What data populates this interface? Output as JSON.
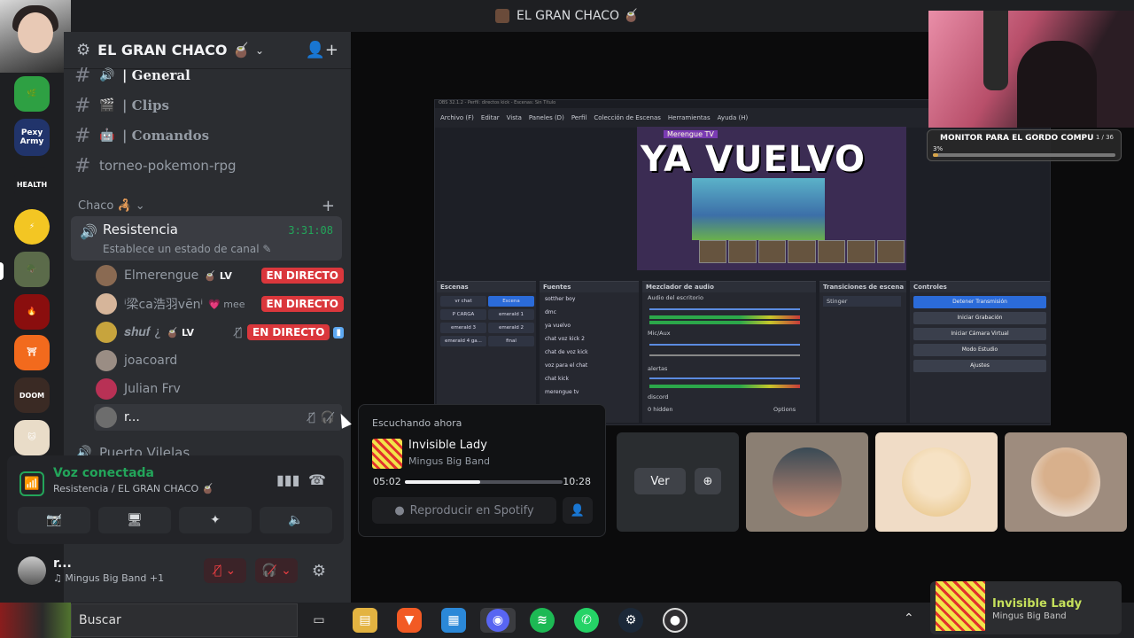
{
  "window": {
    "title": "EL GRAN CHACO 🧉"
  },
  "rail": {
    "servers": [
      {
        "name": "green-leaf-server",
        "text": ""
      },
      {
        "name": "pexy-army-server",
        "text": "Pexy Army"
      },
      {
        "name": "health-server",
        "text": "HEALTH"
      },
      {
        "name": "pikachu-server",
        "text": ""
      },
      {
        "name": "camo-server",
        "text": ""
      },
      {
        "name": "red-logo-server",
        "text": ""
      },
      {
        "name": "orange-server",
        "text": ""
      },
      {
        "name": "doom-server",
        "text": ""
      },
      {
        "name": "cat-server",
        "text": ""
      }
    ]
  },
  "guild": {
    "name": "EL GRAN CHACO 🧉"
  },
  "channels": [
    {
      "label": "| General",
      "emoji": "🔊"
    },
    {
      "label": "| Clips",
      "emoji": "🎬"
    },
    {
      "label": "| Comandos",
      "emoji": "🤖"
    },
    {
      "label": "torneo-pokemon-rpg",
      "emoji": ""
    }
  ],
  "category": {
    "label": "Chaco 🦂"
  },
  "voice_channel": {
    "name": "Resistencia",
    "timer": "3:31:08",
    "status_placeholder": "Establece un estado de canal"
  },
  "members": [
    {
      "name": "Elmerengue",
      "tag": "LV",
      "live": "EN DIRECTO",
      "color": "#8a6a52"
    },
    {
      "name": "ⁱ梁ca浩羽vēnⁱ",
      "tag": "mee",
      "live": "EN DIRECTO",
      "color": "#d6b59a"
    },
    {
      "name": "𝒔𝒉𝒖𝒇 ¿",
      "tag": "LV",
      "live": "EN DIRECTO",
      "color": "#c7a43d"
    },
    {
      "name": "joacoard",
      "tag": "",
      "live": "",
      "color": "#9a8d84"
    },
    {
      "name": "Julian Frv",
      "tag": "",
      "live": "",
      "color": "#b83155"
    },
    {
      "name": "r...",
      "tag": "",
      "live": "",
      "color": "#6d6d6d"
    }
  ],
  "next_channel": "Puerto Vilelas",
  "voice_panel": {
    "state": "Voz conectada",
    "location": "Resistencia / EL GRAN CHACO 🧉"
  },
  "user": {
    "name": "r...",
    "activity": "♫ Mingus Big Band +1"
  },
  "spotify_popout": {
    "label": "Escuchando ahora",
    "song": "Invisible Lady",
    "artist": "Mingus Big Band",
    "current_time": "05:02",
    "end_time": "10:28",
    "progress": 0.48,
    "play_button": "Reproducir en Spotify"
  },
  "watch_tile": {
    "view_label": "Ver"
  },
  "obs": {
    "window_title": "OBS 32.1.2 - Perfil: directos kick - Escenas: Sin Título",
    "menu": [
      "Archivo (F)",
      "Editar",
      "Vista",
      "Paneles (D)",
      "Perfil",
      "Colección de Escenas",
      "Herramientas",
      "Ayuda (H)"
    ],
    "banner_tagline": "Merengue TV",
    "banner": "YA VUELVO",
    "docks": [
      "Escenas",
      "Fuentes",
      "Mezclador de audio",
      "Transiciones de escena",
      "Controles"
    ],
    "scenes": [
      "vr chat",
      "Escena",
      "P CARGA",
      "emerald 1",
      "emerald 3",
      "emerald 2",
      "emerald 4 ga...",
      "final"
    ],
    "sources": [
      "sotther boy",
      "dmc",
      "ya vuelvo",
      "chat voz kick 2",
      "chat de voz kick",
      "voz para el chat",
      "chat kick",
      "merengue tv"
    ],
    "mixer_tracks": [
      "Audio del escritorio",
      "Mic/Aux",
      "alertas",
      "discord"
    ],
    "mixer_footer": "0 hidden",
    "mixer_options": "Options",
    "transition": "Stinger",
    "controls": [
      "Detener Transmisión",
      "Iniciar Grabación",
      "Iniciar Cámara Virtual",
      "Modo Estudio",
      "Ajustes"
    ]
  },
  "goal": {
    "title": "MONITOR PARA EL GORDO COMPU",
    "count": "1 / 36",
    "percent_label": "3%",
    "progress": 0.03
  },
  "taskbar": {
    "search_label": "Buscar",
    "apps": [
      "task-view",
      "file-explorer",
      "brave",
      "microsoft-store",
      "discord",
      "spotify",
      "whatsapp",
      "steam",
      "obs"
    ]
  },
  "now_playing": {
    "song": "Invisible Lady",
    "artist": "Mingus Big Band"
  },
  "colors": {
    "accent_green": "#23a55a",
    "live_red": "#da373c",
    "spotify_green": "#1db954"
  }
}
